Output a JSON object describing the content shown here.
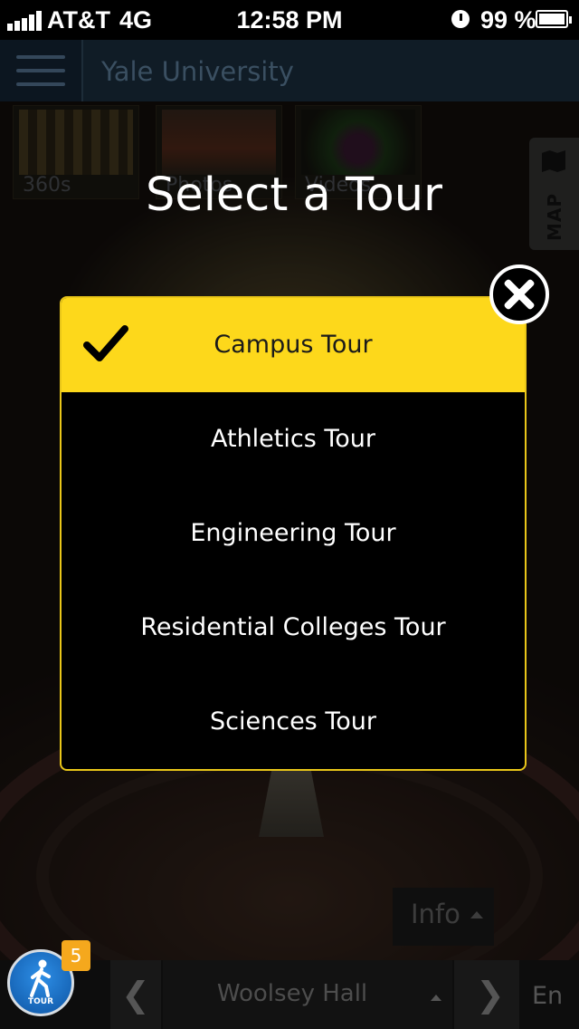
{
  "status_bar": {
    "carrier": "AT&T",
    "network": "4G",
    "time": "12:58 PM",
    "battery_percent": "99 %",
    "battery_level": 0.99,
    "icons": [
      "signal-icon",
      "alarm-clock-icon",
      "battery-charging-icon"
    ]
  },
  "header": {
    "menu_icon": "hamburger-menu-icon",
    "title": "Yale University"
  },
  "media_tabs": [
    {
      "label": "360s"
    },
    {
      "label": "Photos"
    },
    {
      "label": "Videos"
    }
  ],
  "map_tab": {
    "label": "MAP",
    "icon": "map-icon"
  },
  "modal": {
    "title": "Select a Tour",
    "close_icon": "close-x-icon",
    "selected_icon": "checkmark-icon",
    "tours": [
      {
        "label": "Campus Tour",
        "selected": true
      },
      {
        "label": "Athletics Tour",
        "selected": false
      },
      {
        "label": "Engineering Tour",
        "selected": false
      },
      {
        "label": "Residential Colleges Tour",
        "selected": false
      },
      {
        "label": "Sciences Tour",
        "selected": false
      }
    ],
    "accent_color": "#fdd81b"
  },
  "info_button": {
    "label": "Info",
    "icon": "caret-up-icon"
  },
  "bottom_bar": {
    "tour_button_label": "TOUR",
    "tour_icon": "walking-person-icon",
    "stops_badge": "5",
    "prev_icon": "chevron-left-icon",
    "next_icon": "chevron-right-icon",
    "location": "Woolsey Hall",
    "language": "En"
  }
}
